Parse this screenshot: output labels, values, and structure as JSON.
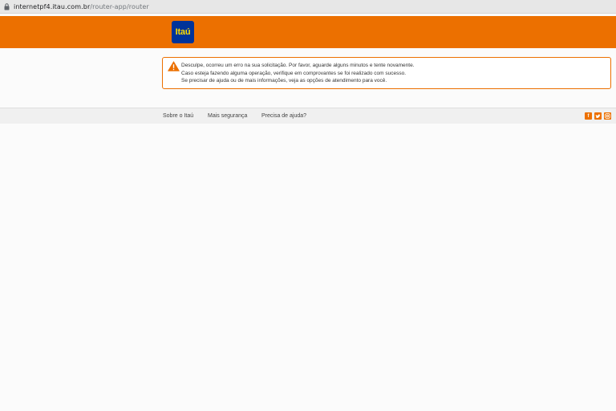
{
  "browser": {
    "url_host": "internetpf4.itau.com.br",
    "url_path": "/router-app/router"
  },
  "header": {
    "logo_text": "Itaú",
    "brand_color": "#ec7000",
    "logo_bg_color": "#003399"
  },
  "error": {
    "icon": "warning-icon",
    "lines": [
      "Desculpe, ocorreu um erro na sua solicitação. Por favor, aguarde alguns minutos e tente novamente.",
      "Caso esteja fazendo alguma operação, verifique em comprovantes se foi realizado com sucesso.",
      "Se precisar de ajuda ou de mais informações, veja as opções de atendimento para você."
    ]
  },
  "footer": {
    "links": [
      "Sobre o Itaú",
      "Mais segurança",
      "Precisa de ajuda?"
    ],
    "social_icons": [
      "facebook-icon",
      "twitter-icon",
      "instagram-icon"
    ]
  }
}
